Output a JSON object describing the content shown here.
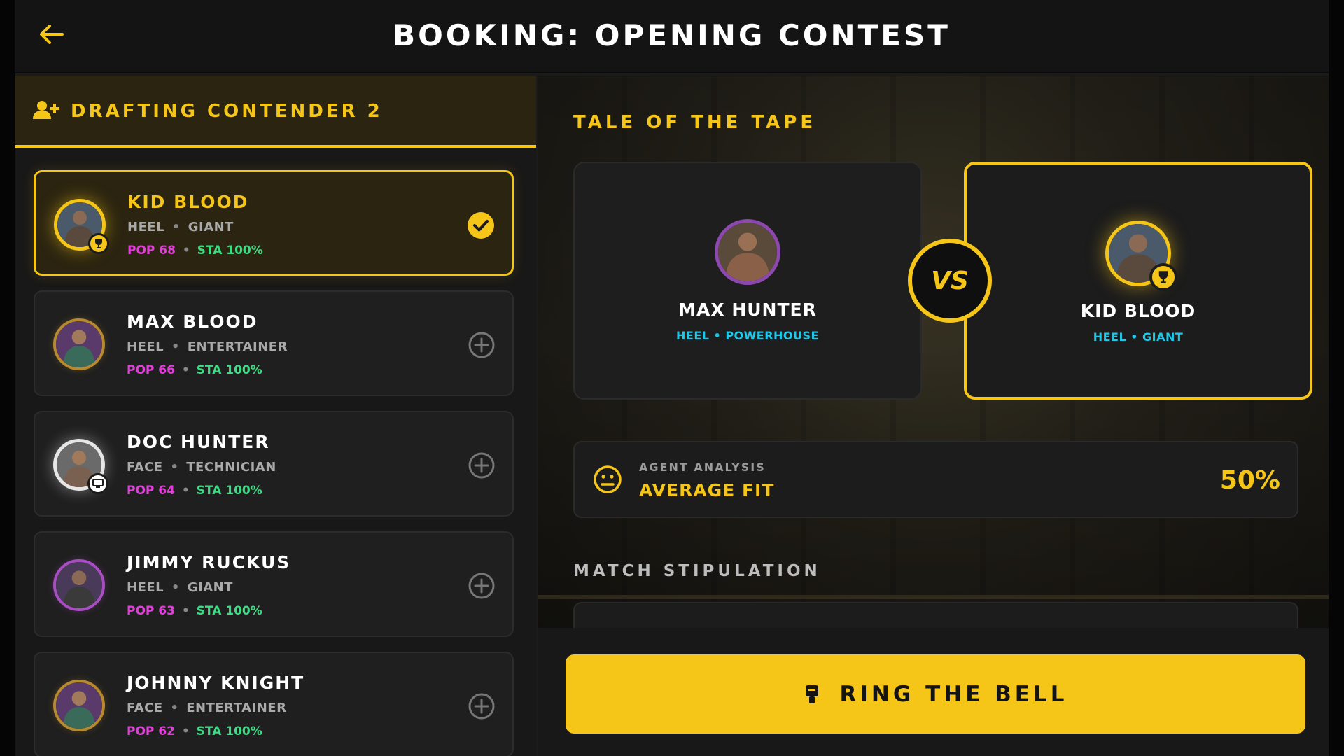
{
  "header": {
    "title": "BOOKING: OPENING CONTEST"
  },
  "left_panel": {
    "title": "DRAFTING CONTENDER 2",
    "roster": [
      {
        "name": "KID BLOOD",
        "alignment": "HEEL",
        "style": "GIANT",
        "pop": "POP 68",
        "sta": "STA 100%",
        "selected": true,
        "avatar_ring": "gold",
        "badge": "trophy"
      },
      {
        "name": "MAX BLOOD",
        "alignment": "HEEL",
        "style": "ENTERTAINER",
        "pop": "POP 66",
        "sta": "STA 100%",
        "selected": false,
        "avatar_ring": "bronze"
      },
      {
        "name": "DOC HUNTER",
        "alignment": "FACE",
        "style": "TECHNICIAN",
        "pop": "POP 64",
        "sta": "STA 100%",
        "selected": false,
        "avatar_ring": "silver",
        "badge": "tv"
      },
      {
        "name": "JIMMY RUCKUS",
        "alignment": "HEEL",
        "style": "GIANT",
        "pop": "POP 63",
        "sta": "STA 100%",
        "selected": false,
        "avatar_ring": "purple"
      },
      {
        "name": "JOHNNY KNIGHT",
        "alignment": "FACE",
        "style": "ENTERTAINER",
        "pop": "POP 62",
        "sta": "STA 100%",
        "selected": false,
        "avatar_ring": "bronze"
      }
    ]
  },
  "right_panel": {
    "tale_title": "TALE OF THE TAPE",
    "vs_label": "VS",
    "contender_1": {
      "name": "MAX HUNTER",
      "meta": "HEEL • POWERHOUSE"
    },
    "contender_2": {
      "name": "KID BLOOD",
      "meta": "HEEL • GIANT"
    },
    "analysis": {
      "label": "AGENT ANALYSIS",
      "value": "AVERAGE FIT",
      "percent": "50%",
      "icon": "neutral-face-icon"
    },
    "stipulation_title": "MATCH STIPULATION",
    "action_button": {
      "label": "RING THE BELL",
      "icon": "bell-icon"
    }
  },
  "colors": {
    "accent": "#f5c518",
    "pop": "#e040d8",
    "sta": "#3ddc84",
    "meta_cyan": "#1ec8e8"
  }
}
